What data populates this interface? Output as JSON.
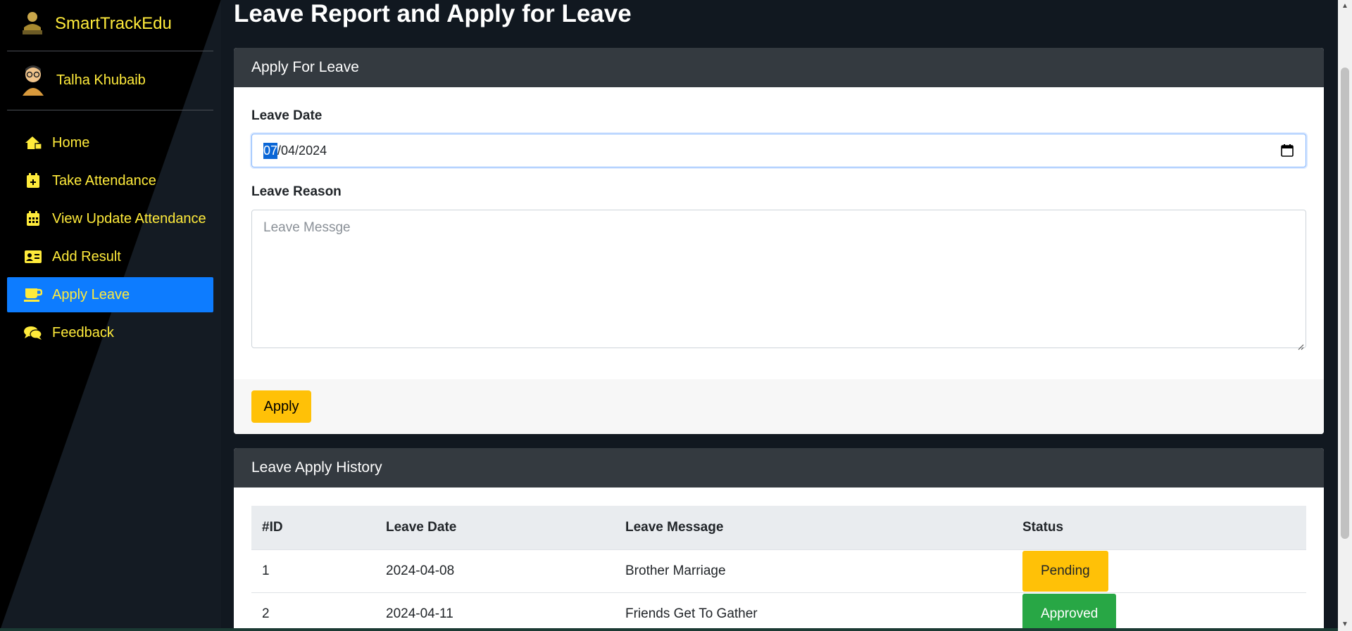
{
  "app": {
    "brand": "SmartTrackEdu",
    "user_name": "Talha Khubaib",
    "accent": "#ffeb3b",
    "active_color": "#0d7cff"
  },
  "sidebar": {
    "items": [
      {
        "label": "Home",
        "icon": "home-icon"
      },
      {
        "label": "Take Attendance",
        "icon": "calendar-plus-icon"
      },
      {
        "label": "View Update Attendance",
        "icon": "calendar-icon"
      },
      {
        "label": "Add Result",
        "icon": "id-card-icon"
      },
      {
        "label": "Apply Leave",
        "icon": "coffee-icon",
        "active": true
      },
      {
        "label": "Feedback",
        "icon": "comments-icon"
      }
    ]
  },
  "page": {
    "title": "Leave Report and Apply for Leave"
  },
  "apply_form": {
    "header": "Apply For Leave",
    "date_label": "Leave Date",
    "date_value_day": "07",
    "date_value_rest": "/04/2024",
    "reason_label": "Leave Reason",
    "reason_placeholder": "Leave Messge",
    "submit_label": "Apply"
  },
  "history": {
    "header": "Leave Apply History",
    "columns": [
      "#ID",
      "Leave Date",
      "Leave Message",
      "Status"
    ],
    "rows": [
      {
        "id": "1",
        "date": "2024-04-08",
        "message": "Brother Marriage",
        "status": "Pending"
      },
      {
        "id": "2",
        "date": "2024-04-11",
        "message": "Friends Get To Gather",
        "status": "Approved"
      }
    ]
  }
}
